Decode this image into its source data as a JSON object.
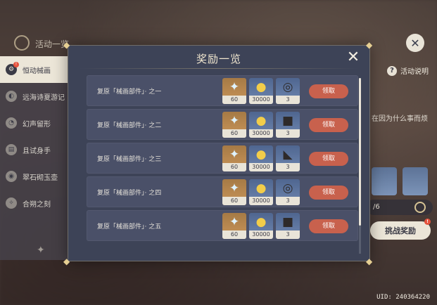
{
  "background": {
    "topbar_title": "活动一览",
    "help_label": "活动说明",
    "story_text": "在因为什么事而烦",
    "progress_text": "/6",
    "challenge_label": "挑战奖励",
    "challenge_badge": "!",
    "uid": "UID: 240364220"
  },
  "sidebar": {
    "items": [
      {
        "label": "恒动械画",
        "icon": "mechanical-icon",
        "active": true,
        "badge": "!"
      },
      {
        "label": "远海诗夏游记",
        "icon": "shell-icon"
      },
      {
        "label": "幻声留形",
        "icon": "fan-icon"
      },
      {
        "label": "且试身手",
        "icon": "cards-icon"
      },
      {
        "label": "翠石砌玉壶",
        "icon": "teapot-icon"
      },
      {
        "label": "合朔之刻",
        "icon": "leaf-icon"
      }
    ]
  },
  "modal": {
    "title": "奖励一览",
    "claim_label": "领取",
    "rows": [
      {
        "title": "复原「械画部件」· 之一",
        "rewards": [
          {
            "icon": "primogem-icon",
            "count": "60"
          },
          {
            "icon": "mora-icon",
            "count": "30000"
          },
          {
            "icon": "ring-material-icon",
            "count": "3"
          }
        ]
      },
      {
        "title": "复原「械画部件」· 之二",
        "rewards": [
          {
            "icon": "primogem-icon",
            "count": "60"
          },
          {
            "icon": "mora-icon",
            "count": "30000"
          },
          {
            "icon": "box-material-icon",
            "count": "3"
          }
        ]
      },
      {
        "title": "复原「械画部件」· 之三",
        "rewards": [
          {
            "icon": "primogem-icon",
            "count": "60"
          },
          {
            "icon": "mora-icon",
            "count": "30000"
          },
          {
            "icon": "horn-material-icon",
            "count": "3"
          }
        ]
      },
      {
        "title": "复原「械画部件」· 之四",
        "rewards": [
          {
            "icon": "primogem-icon",
            "count": "60"
          },
          {
            "icon": "mora-icon",
            "count": "30000"
          },
          {
            "icon": "ring-material-icon",
            "count": "3"
          }
        ]
      },
      {
        "title": "复原「械画部件」· 之五",
        "rewards": [
          {
            "icon": "primogem-icon",
            "count": "60"
          },
          {
            "icon": "mora-icon",
            "count": "30000"
          },
          {
            "icon": "box-material-icon",
            "count": "3"
          }
        ]
      }
    ]
  },
  "colors": {
    "modal_bg": "#3d4357",
    "row_bg": "#4a5068",
    "claim_button": "#c8614d",
    "gold_frame": "#c9955a",
    "blue_frame": "#6f87b0"
  }
}
